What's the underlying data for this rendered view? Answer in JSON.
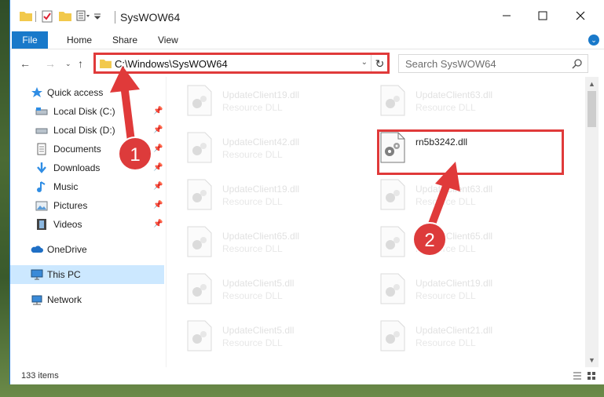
{
  "window": {
    "title": "SysWOW64"
  },
  "ribbon": {
    "tabs": [
      {
        "label": "File"
      },
      {
        "label": "Home"
      },
      {
        "label": "Share"
      },
      {
        "label": "View"
      }
    ]
  },
  "address": {
    "path": "C:\\Windows\\SysWOW64"
  },
  "search": {
    "placeholder": "Search SysWOW64"
  },
  "nav": {
    "items": [
      {
        "label": "Quick access",
        "icon": "star-icon",
        "pinned": false
      },
      {
        "label": "Local Disk (C:)",
        "icon": "drive-icon",
        "pinned": true
      },
      {
        "label": "Local Disk (D:)",
        "icon": "drive-icon",
        "pinned": true
      },
      {
        "label": "Documents",
        "icon": "document-icon",
        "pinned": true
      },
      {
        "label": "Downloads",
        "icon": "download-icon",
        "pinned": true
      },
      {
        "label": "Music",
        "icon": "music-icon",
        "pinned": true
      },
      {
        "label": "Pictures",
        "icon": "pictures-icon",
        "pinned": true
      },
      {
        "label": "Videos",
        "icon": "film-icon",
        "pinned": true
      },
      {
        "label": "OneDrive",
        "icon": "cloud-icon",
        "pinned": false
      },
      {
        "label": "This PC",
        "icon": "computer-icon",
        "pinned": false
      },
      {
        "label": "Network",
        "icon": "network-icon",
        "pinned": false
      }
    ]
  },
  "files": {
    "left_column": [
      {
        "name": "UpdateClient19.dll",
        "type": "Resource DLL"
      },
      {
        "name": "UpdateClient42.dll",
        "type": "Resource DLL"
      },
      {
        "name": "UpdateClient19.dll",
        "type": "Resource DLL"
      },
      {
        "name": "UpdateClient65.dll",
        "type": "Resource DLL"
      },
      {
        "name": "UpdateClient5.dll",
        "type": "Resource DLL"
      },
      {
        "name": "UpdateClient5.dll",
        "type": "Resource DLL"
      }
    ],
    "right_column": [
      {
        "name": "UpdateClient63.dll",
        "type": "Resource DLL"
      },
      {
        "name": "rn5b3242.dll",
        "type": ""
      },
      {
        "name": "UpdateClient63.dll",
        "type": "Resource DLL"
      },
      {
        "name": "UpdateClient65.dll",
        "type": "Resource DLL"
      },
      {
        "name": "UpdateClient19.dll",
        "type": "Resource DLL"
      },
      {
        "name": "UpdateClient21.dll",
        "type": "Resource DLL"
      }
    ]
  },
  "status": {
    "item_count": "133 items"
  },
  "annotations": {
    "badge1": "1",
    "badge2": "2",
    "color": "#e03a3a"
  },
  "colors": {
    "accent": "#1979ca",
    "selected": "#cce8ff"
  }
}
